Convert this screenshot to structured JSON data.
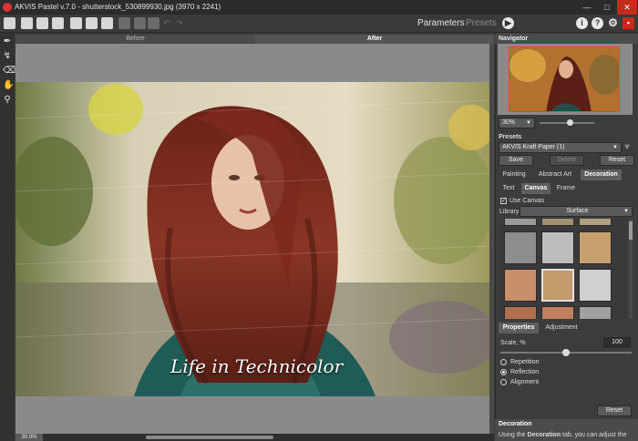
{
  "window": {
    "title": "AKVIS Pastel v.7.0 - shutterstock_530899930.jpg (3970 x 2241)"
  },
  "toolbar": {
    "parameters_label": "Parameters",
    "presets_label": "Presets"
  },
  "view_tabs": {
    "before": "Before",
    "after": "After"
  },
  "image": {
    "caption": "Life in Technicolor"
  },
  "status": {
    "zoom": "30.0%"
  },
  "navigator": {
    "title": "Navigator",
    "zoom": "30%"
  },
  "presets": {
    "title": "Presets",
    "selected": "AKVIS Kraft Paper (1)",
    "save_label": "Save",
    "delete_label": "Delete",
    "reset_label": "Reset"
  },
  "effect_tabs": {
    "painting": "Painting",
    "abstract_art": "Abstract Art",
    "decoration": "Decoration"
  },
  "decoration_tabs": {
    "text": "Text",
    "canvas": "Canvas",
    "frame": "Frame"
  },
  "canvas_settings": {
    "use_canvas_label": "Use Canvas",
    "use_canvas_checked": true,
    "library_label": "Library",
    "library_value": "Surface"
  },
  "props_tabs": {
    "properties": "Properties",
    "adjustment": "Adjustment"
  },
  "properties": {
    "scale_label": "Scale, %",
    "scale_value": "100",
    "scale_fraction": 0.5,
    "options": [
      "Repetition",
      "Reflection",
      "Alignment"
    ],
    "selected_option": "Reflection",
    "reset_label": "Reset"
  },
  "help": {
    "title": "Decoration",
    "text_prefix": "Using the ",
    "text_bold": "Decoration",
    "text_suffix": " tab, you can adjust the"
  },
  "colors": {
    "close": "#c42b1c",
    "accent": "#3b7dd8",
    "highlight": "#ff3b30"
  }
}
